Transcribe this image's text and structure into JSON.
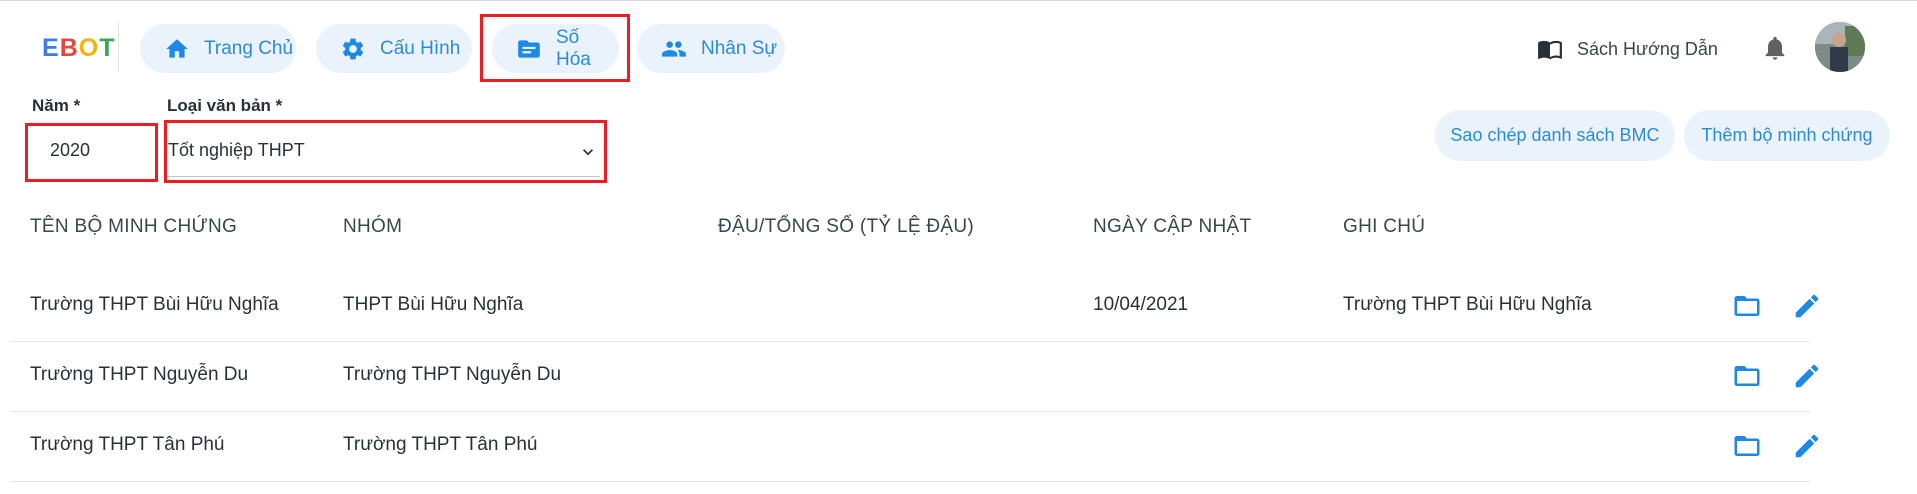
{
  "header": {
    "logo_letters": [
      "E",
      "B",
      "O",
      "T"
    ],
    "nav": [
      {
        "label": "Trang Chủ",
        "icon": "home-icon"
      },
      {
        "label": "Cấu Hình",
        "icon": "gear-icon"
      },
      {
        "label": "Số Hóa",
        "icon": "folder-doc-icon"
      },
      {
        "label": "Nhân Sự",
        "icon": "people-icon"
      }
    ],
    "guide_label": "Sách Hướng Dẫn",
    "guide_icon": "book-icon",
    "bell_icon": "bell-icon"
  },
  "filters": {
    "year_label": "Năm *",
    "year_value": "2020",
    "type_label": "Loại văn bản *",
    "type_value": "Tốt nghiệp THPT"
  },
  "actions": {
    "copy_label": "Sao chép danh sách BMC",
    "add_label": "Thêm bộ minh chứng"
  },
  "table": {
    "headers": [
      "TÊN BỘ MINH CHỨNG",
      "NHÓM",
      "ĐẬU/TỔNG SỐ (TỶ LỆ ĐẬU)",
      "NGÀY CẬP NHẬT",
      "GHI CHÚ"
    ],
    "rows": [
      {
        "name": "Trường THPT Bùi Hữu Nghĩa",
        "group": "THPT Bùi Hữu Nghĩa",
        "ratio": "",
        "updated": "10/04/2021",
        "note": "Trường THPT Bùi Hữu Nghĩa"
      },
      {
        "name": "Trường THPT Nguyễn Du",
        "group": "Trường THPT Nguyễn Du",
        "ratio": "",
        "updated": "",
        "note": ""
      },
      {
        "name": "Trường THPT Tân Phú",
        "group": "Trường THPT Tân Phú",
        "ratio": "",
        "updated": "",
        "note": ""
      }
    ]
  },
  "colors": {
    "accent": "#1e88e5",
    "pill_bg": "#eaf3fc",
    "highlight": "#ee1c25"
  }
}
